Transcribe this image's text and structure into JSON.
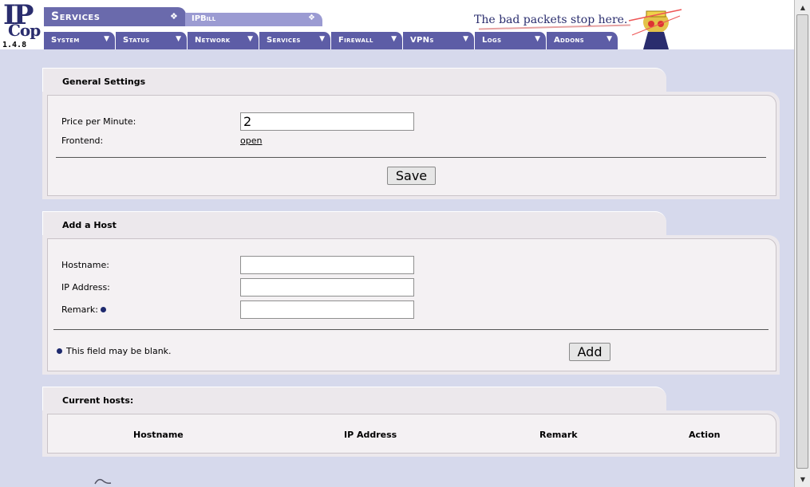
{
  "header": {
    "logo_ip": "IP",
    "logo_cop": "Cop",
    "version": "1.4.8",
    "section_title": "Services",
    "section_icon": "diamond-pattern-icon",
    "subsection_title": "IPBill",
    "subsection_icon": "diamond-pattern-icon",
    "slogan": "The bad packets stop here.",
    "nav": [
      {
        "label": "System"
      },
      {
        "label": "Status"
      },
      {
        "label": "Network"
      },
      {
        "label": "Services"
      },
      {
        "label": "Firewall"
      },
      {
        "label": "VPNs"
      },
      {
        "label": "Logs"
      },
      {
        "label": "Addons"
      }
    ]
  },
  "general": {
    "title": "General Settings",
    "price_label": "Price per Minute:",
    "price_value": "2",
    "frontend_label": "Frontend:",
    "frontend_link": "open",
    "save_label": "Save"
  },
  "add_host": {
    "title": "Add a Host",
    "hostname_label": "Hostname:",
    "hostname_value": "",
    "ip_label": "IP Address:",
    "ip_value": "",
    "remark_label": "Remark:",
    "remark_value": "",
    "blank_note": "This field may be blank.",
    "add_label": "Add"
  },
  "hosts": {
    "title": "Current hosts:",
    "columns": [
      "Hostname",
      "IP Address",
      "Remark",
      "Action"
    ],
    "rows": []
  },
  "colors": {
    "nav_bg": "#5d5da6",
    "section_bg": "#6a6aac",
    "page_bg": "#d6d9ec",
    "panel_bg": "#ece8ec",
    "bullet": "#1e2a6e"
  }
}
